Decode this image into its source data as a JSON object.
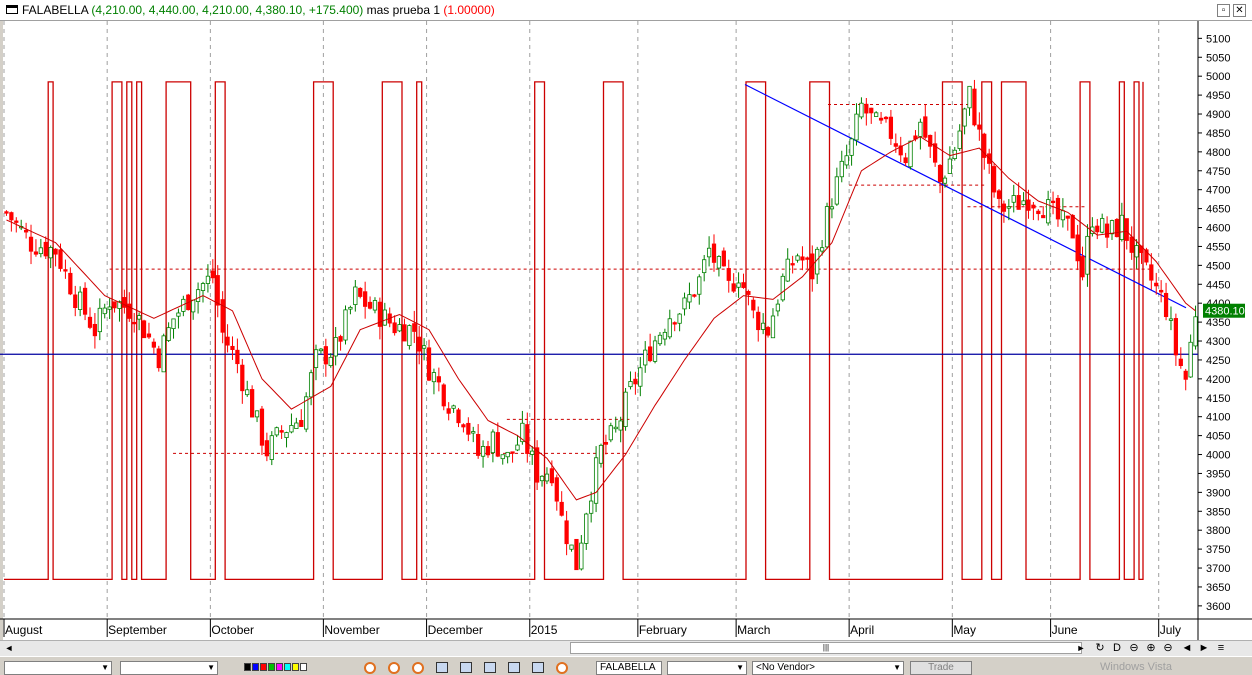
{
  "window": {
    "symbol": "FALABELLA",
    "ohlc_text": "(4,210.00, 4,440.00, 4,210.00, 4,380.10, +175.400)",
    "indicator_name": "mas prueba 1",
    "indicator_value": "(1.00000)",
    "restore_label": "▫",
    "close_label": "✕"
  },
  "chart_data": {
    "type": "candlestick",
    "y_ticks": [
      5100,
      5050,
      5000,
      4950,
      4900,
      4850,
      4800,
      4750,
      4700,
      4650,
      4600,
      4550,
      4500,
      4450,
      4400,
      4350,
      4300,
      4250,
      4200,
      4150,
      4100,
      4050,
      4000,
      3950,
      3900,
      3850,
      3800,
      3750,
      3700,
      3650,
      3600
    ],
    "y_tick_labels": [
      "5100",
      "5050",
      "5000",
      "4950",
      "4900",
      "4850",
      "4800",
      "4750",
      "4700",
      "4650",
      "4600",
      "4550",
      "4500",
      "4450",
      "4400",
      "4350",
      "4300",
      "4250",
      "4200",
      "4150",
      "4100",
      "4050",
      "4000",
      "3950",
      "3900",
      "3850",
      "3800",
      "3750",
      "3700",
      "3650",
      "3600"
    ],
    "ylim": [
      3560,
      5130
    ],
    "last_price": 4380.1,
    "last_price_label": "4380.10",
    "months": [
      {
        "label": "August",
        "index": 0
      },
      {
        "label": "September",
        "index": 21
      },
      {
        "label": "October",
        "index": 42
      },
      {
        "label": "November",
        "index": 65
      },
      {
        "label": "December",
        "index": 86
      },
      {
        "label": "2015",
        "index": 107
      },
      {
        "label": "February",
        "index": 129
      },
      {
        "label": "March",
        "index": 149
      },
      {
        "label": "April",
        "index": 172
      },
      {
        "label": "May",
        "index": 193
      },
      {
        "label": "June",
        "index": 213
      },
      {
        "label": "July",
        "index": 235
      }
    ],
    "bars": 243,
    "close_path": [
      [
        0,
        4640
      ],
      [
        5,
        4560
      ],
      [
        10,
        4540
      ],
      [
        14,
        4420
      ],
      [
        18,
        4330
      ],
      [
        21,
        4410
      ],
      [
        26,
        4380
      ],
      [
        31,
        4260
      ],
      [
        34,
        4360
      ],
      [
        38,
        4430
      ],
      [
        42,
        4470
      ],
      [
        44,
        4320
      ],
      [
        47,
        4240
      ],
      [
        50,
        4120
      ],
      [
        53,
        4010
      ],
      [
        56,
        4060
      ],
      [
        60,
        4100
      ],
      [
        63,
        4250
      ],
      [
        67,
        4280
      ],
      [
        71,
        4420
      ],
      [
        75,
        4380
      ],
      [
        79,
        4340
      ],
      [
        83,
        4330
      ],
      [
        86,
        4230
      ],
      [
        90,
        4140
      ],
      [
        93,
        4100
      ],
      [
        96,
        4000
      ],
      [
        99,
        4040
      ],
      [
        102,
        3990
      ],
      [
        105,
        4050
      ],
      [
        108,
        3950
      ],
      [
        111,
        3960
      ],
      [
        113,
        3830
      ],
      [
        116,
        3710
      ],
      [
        118,
        3860
      ],
      [
        121,
        4010
      ],
      [
        124,
        4060
      ],
      [
        127,
        4170
      ],
      [
        131,
        4280
      ],
      [
        135,
        4370
      ],
      [
        138,
        4390
      ],
      [
        141,
        4460
      ],
      [
        143,
        4540
      ],
      [
        147,
        4440
      ],
      [
        149,
        4480
      ],
      [
        152,
        4370
      ],
      [
        155,
        4330
      ],
      [
        158,
        4460
      ],
      [
        161,
        4530
      ],
      [
        164,
        4480
      ],
      [
        168,
        4680
      ],
      [
        172,
        4820
      ],
      [
        174,
        4920
      ],
      [
        177,
        4870
      ],
      [
        180,
        4850
      ],
      [
        183,
        4790
      ],
      [
        186,
        4880
      ],
      [
        190,
        4720
      ],
      [
        193,
        4810
      ],
      [
        196,
        4950
      ],
      [
        199,
        4790
      ],
      [
        202,
        4650
      ],
      [
        205,
        4660
      ],
      [
        208,
        4680
      ],
      [
        211,
        4660
      ],
      [
        214,
        4620
      ],
      [
        217,
        4590
      ],
      [
        219,
        4480
      ],
      [
        221,
        4630
      ],
      [
        224,
        4580
      ],
      [
        227,
        4610
      ],
      [
        230,
        4520
      ],
      [
        233,
        4460
      ],
      [
        236,
        4390
      ],
      [
        238,
        4270
      ],
      [
        240,
        4200
      ],
      [
        242,
        4380
      ]
    ],
    "ma_path": [
      [
        0,
        4620
      ],
      [
        10,
        4560
      ],
      [
        20,
        4420
      ],
      [
        30,
        4360
      ],
      [
        40,
        4420
      ],
      [
        46,
        4380
      ],
      [
        52,
        4200
      ],
      [
        58,
        4120
      ],
      [
        66,
        4180
      ],
      [
        72,
        4330
      ],
      [
        80,
        4370
      ],
      [
        86,
        4330
      ],
      [
        92,
        4200
      ],
      [
        98,
        4090
      ],
      [
        104,
        4050
      ],
      [
        110,
        3990
      ],
      [
        116,
        3880
      ],
      [
        120,
        3900
      ],
      [
        126,
        4000
      ],
      [
        132,
        4130
      ],
      [
        138,
        4250
      ],
      [
        144,
        4360
      ],
      [
        150,
        4420
      ],
      [
        156,
        4410
      ],
      [
        162,
        4470
      ],
      [
        168,
        4560
      ],
      [
        174,
        4750
      ],
      [
        180,
        4800
      ],
      [
        186,
        4840
      ],
      [
        192,
        4790
      ],
      [
        198,
        4810
      ],
      [
        204,
        4730
      ],
      [
        210,
        4670
      ],
      [
        216,
        4640
      ],
      [
        222,
        4580
      ],
      [
        228,
        4590
      ],
      [
        234,
        4510
      ],
      [
        240,
        4400
      ],
      [
        242,
        4380
      ]
    ],
    "signal_segments": [
      [
        0,
        0
      ],
      [
        9,
        0
      ],
      [
        9,
        1
      ],
      [
        10,
        1
      ],
      [
        10,
        0
      ],
      [
        22,
        0
      ],
      [
        22,
        1
      ],
      [
        24,
        1
      ],
      [
        24,
        0
      ],
      [
        25,
        0
      ],
      [
        25,
        1
      ],
      [
        26,
        1
      ],
      [
        26,
        0
      ],
      [
        27,
        0
      ],
      [
        27,
        1
      ],
      [
        28,
        1
      ],
      [
        28,
        0
      ],
      [
        33,
        0
      ],
      [
        33,
        1
      ],
      [
        38,
        1
      ],
      [
        38,
        0
      ],
      [
        43,
        0
      ],
      [
        43,
        1
      ],
      [
        45,
        1
      ],
      [
        45,
        0
      ],
      [
        63,
        0
      ],
      [
        63,
        1
      ],
      [
        67,
        1
      ],
      [
        67,
        0
      ],
      [
        77,
        0
      ],
      [
        77,
        1
      ],
      [
        81,
        1
      ],
      [
        81,
        0
      ],
      [
        84,
        0
      ],
      [
        84,
        1
      ],
      [
        85,
        1
      ],
      [
        85,
        0
      ],
      [
        108,
        0
      ],
      [
        108,
        1
      ],
      [
        110,
        1
      ],
      [
        110,
        0
      ],
      [
        122,
        0
      ],
      [
        122,
        1
      ],
      [
        126,
        1
      ],
      [
        126,
        0
      ],
      [
        151,
        0
      ],
      [
        151,
        1
      ],
      [
        155,
        1
      ],
      [
        155,
        0
      ],
      [
        164,
        0
      ],
      [
        164,
        1
      ],
      [
        168,
        1
      ],
      [
        168,
        0
      ],
      [
        191,
        0
      ],
      [
        191,
        1
      ],
      [
        195,
        1
      ],
      [
        195,
        0
      ],
      [
        199,
        0
      ],
      [
        199,
        1
      ],
      [
        201,
        1
      ],
      [
        201,
        0
      ],
      [
        203,
        0
      ],
      [
        203,
        1
      ],
      [
        208,
        1
      ],
      [
        208,
        0
      ],
      [
        219,
        0
      ],
      [
        219,
        1
      ],
      [
        221,
        1
      ],
      [
        221,
        0
      ],
      [
        227,
        0
      ],
      [
        227,
        1
      ],
      [
        228,
        1
      ],
      [
        228,
        0
      ],
      [
        230,
        0
      ],
      [
        230,
        1
      ],
      [
        231,
        1
      ],
      [
        231,
        0
      ],
      [
        232,
        0
      ],
      [
        232,
        1
      ],
      [
        234,
        1
      ],
      [
        234,
        0
      ],
      [
        235,
        0
      ],
      [
        235,
        1
      ],
      [
        236,
        1
      ],
      [
        236,
        0
      ],
      [
        254,
        0
      ],
      [
        254,
        1
      ],
      [
        255,
        1
      ],
      [
        255,
        0
      ],
      [
        268,
        0
      ],
      [
        268,
        1
      ],
      [
        269,
        1
      ]
    ],
    "support_level": 4265,
    "dashed_levels": [
      {
        "from": 25,
        "to": 152,
        "y": 4490,
        "extend_to": 272
      },
      {
        "from": 40,
        "to": 148,
        "y": 4003
      },
      {
        "from": 119,
        "to": 148,
        "y": 4093
      },
      {
        "from": 195,
        "to": 228,
        "y": 4925
      },
      {
        "from": 200,
        "to": 232,
        "y": 4712
      },
      {
        "from": 228,
        "to": 256,
        "y": 4655
      }
    ],
    "trendline": {
      "x1": 226,
      "y1": 4978,
      "x2": 282,
      "y2": 4388
    },
    "colors": {
      "up": "#008000",
      "down": "#ff0000",
      "ma": "#cc0000",
      "signal": "#cc0000",
      "support": "#0000a0",
      "trend": "#0000ff",
      "dashed": "#cc0000",
      "price_tag_bg": "#008000"
    }
  },
  "scrollbar": {
    "left_arrow": "◄",
    "right_arrow": "►",
    "thumb_grip": "|||",
    "nav_icons": [
      "↻",
      "D",
      "⊖",
      "⊕",
      "⊖",
      "◄",
      "►",
      "≡"
    ]
  },
  "toolbar": {
    "combo1": "",
    "combo2": "",
    "palette": [
      "#000000",
      "#0000ff",
      "#ff0000",
      "#00c000",
      "#ff00ff",
      "#00ffff",
      "#ffff00",
      "#ffffff"
    ],
    "symbol_combo": "FALABELLA",
    "interval_combo": "",
    "vendor_combo": "<No Vendor>",
    "trade_button": "Trade",
    "watermark": "Windows Vista"
  }
}
